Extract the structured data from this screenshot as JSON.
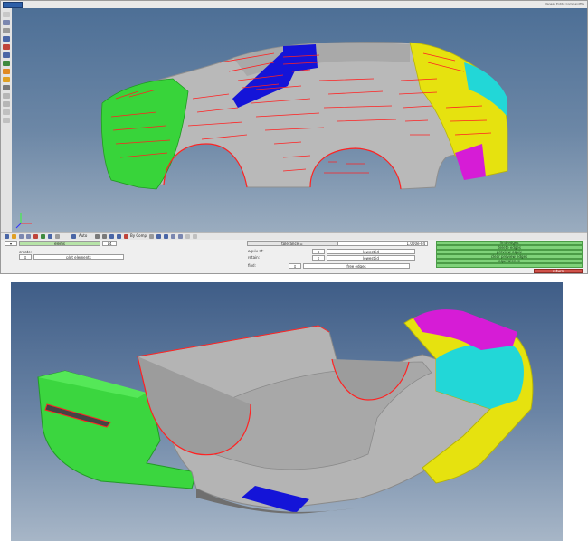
{
  "app": {
    "menu_button_label": "Hypermesh",
    "status_text": "Manage Entity: CommandFile"
  },
  "left_toolbar": {
    "icons": [
      "select-icon",
      "rotate-icon",
      "pan-icon",
      "zoom-icon",
      "fit-icon",
      "view-icon",
      "mesh-icon",
      "geometry-icon",
      "display-icon",
      "component-icon",
      "color-icon",
      "visibility-icon",
      "shading-icon",
      "wireframe-icon"
    ]
  },
  "bottom_toolbar": {
    "view_label": "Auto",
    "component_label": "By Comp"
  },
  "panel": {
    "entity_selector_value": "elems",
    "entity_count": "14",
    "create_label": "create:",
    "plot_elements_label": "plot elements",
    "tolerance_label": "tolerance =",
    "tolerance_value": "1.000e-04",
    "equiv_label": "equiv at:",
    "retain_label": "retain:",
    "equiv_value": "lowest id",
    "retain_value": "lowest id",
    "find_label": "find:",
    "find_value": "free edges",
    "actions": [
      "find edges",
      "delete edges",
      "preview equiv",
      "clear preview edges",
      "equivalence"
    ],
    "return_label": "return"
  },
  "colors": {
    "viewport_top": "#4d6f96",
    "body_gray": "#b8b8b8",
    "green": "#38d43a",
    "blue": "#1414d8",
    "yellow": "#e6e20f",
    "cyan": "#22d7d7",
    "magenta": "#d61cd6",
    "red_edges": "#ff2222"
  }
}
